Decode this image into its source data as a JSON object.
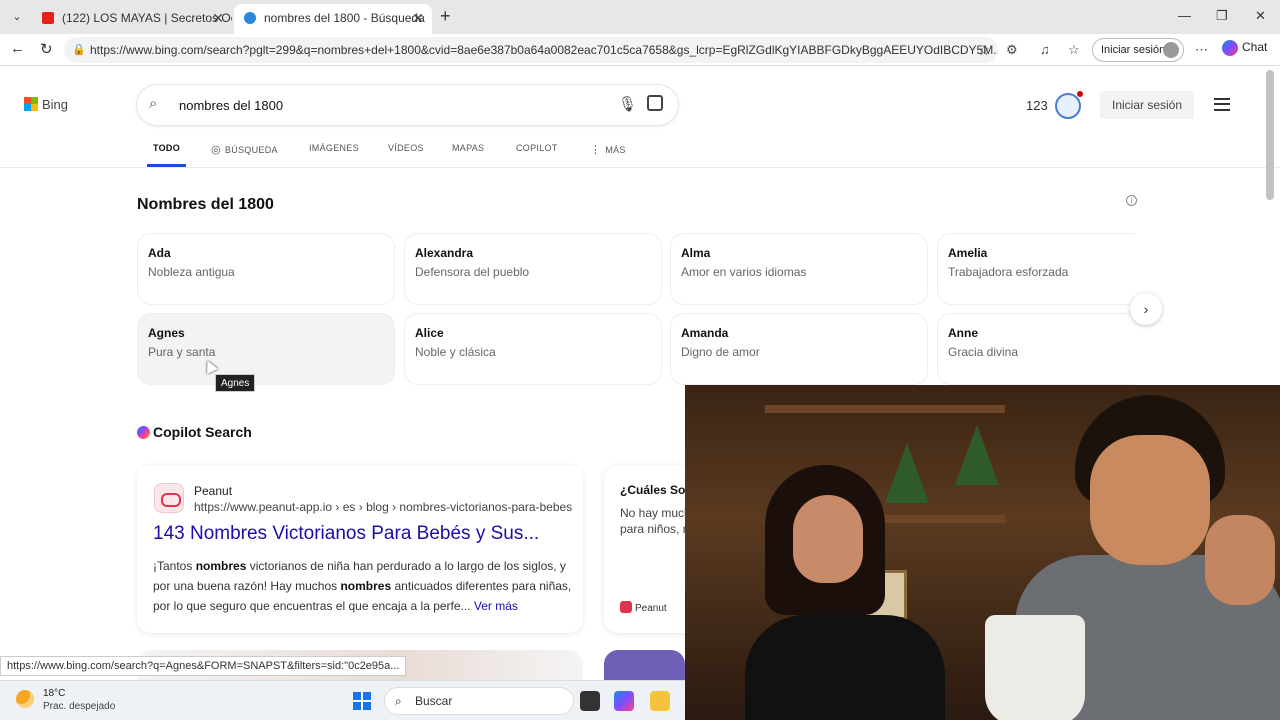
{
  "browser": {
    "tabs": [
      {
        "title": "(122) LOS MAYAS | Secretos Ocult"
      },
      {
        "title": "nombres del 1800 - Búsqueda"
      }
    ],
    "url": "https://www.bing.com/search?pglt=299&q=nombres+del+1800&cvid=8ae6e387b0a64a0082eac701c5ca7658&gs_lcrp=EgRlZGdlKgYIABBFGDkyBggAEEUYOdIBCDY5M...",
    "signin_label": "Iniciar sesión",
    "chat_label": "Chat"
  },
  "bing": {
    "logo_text": "Bing",
    "query": "nombres del 1800",
    "points": "123",
    "signin_label": "Iniciar sesión"
  },
  "search_tabs": [
    {
      "label": "TODO"
    },
    {
      "label": "BÚSQUEDA"
    },
    {
      "label": "IMÁGENES"
    },
    {
      "label": "VÍDEOS"
    },
    {
      "label": "MAPAS"
    },
    {
      "label": "COPILOT"
    },
    {
      "label": "MÁS"
    }
  ],
  "answer": {
    "title": "Nombres del 1800",
    "names": [
      {
        "name": "Ada",
        "meaning": "Nobleza antigua"
      },
      {
        "name": "Alexandra",
        "meaning": "Defensora del pueblo"
      },
      {
        "name": "Alma",
        "meaning": "Amor en varios idiomas"
      },
      {
        "name": "Amelia",
        "meaning": "Trabajadora esforzada"
      },
      {
        "name": "Agnes",
        "meaning": "Pura y santa"
      },
      {
        "name": "Alice",
        "meaning": "Noble y clásica"
      },
      {
        "name": "Amanda",
        "meaning": "Digno de amor"
      },
      {
        "name": "Anne",
        "meaning": "Gracia divina"
      }
    ],
    "tooltip": "Agnes"
  },
  "copilot": {
    "title": "Copilot Search",
    "result": {
      "site_name": "Peanut",
      "site_url": "https://www.peanut-app.io › es › blog › nombres-victorianos-para-bebes",
      "title": "143 Nombres Victorianos Para Bebés y Sus...",
      "snippet_parts": [
        "¡Tantos ",
        "nombres",
        " victorianos de niña han perdurado a lo largo de los siglos, y por una buena razón! Hay muchos ",
        "nombres",
        " anticuados diferentes para niñas, por lo que seguro que encuentras el que encaja a la perfe... "
      ],
      "more_label": "Ver más"
    },
    "side_card": {
      "question": "¿Cuáles Son",
      "answer": "No hay much bebés y del s para niños, n elaborado un",
      "source": "Peanut"
    }
  },
  "status_url": "https://www.bing.com/search?q=Agnes&FORM=SNAPST&filters=sid:\"0c2e95a...",
  "taskbar": {
    "temp": "18°C",
    "condition": "Prac. despejado",
    "search_label": "Buscar"
  }
}
